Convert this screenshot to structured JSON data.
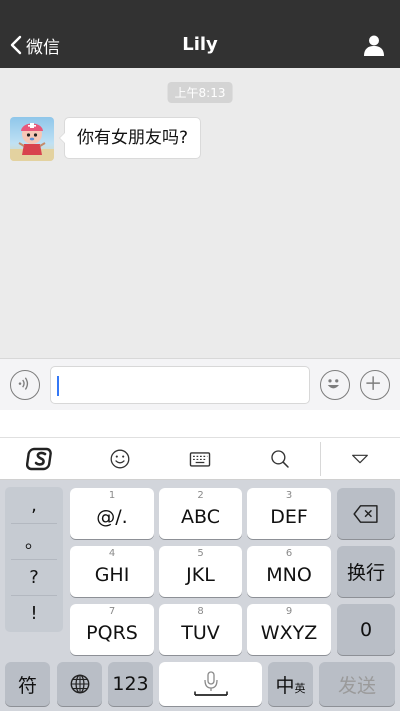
{
  "navbar": {
    "back_label": "微信",
    "title": "Lily",
    "profile_icon": "person-icon"
  },
  "chat": {
    "timestamp": "上午8:13",
    "messages": [
      {
        "sender": "Lily",
        "text": "你有女朋友吗?"
      }
    ]
  },
  "inputbar": {
    "voice_icon": "voice-icon",
    "text_value": "",
    "emoji_icon": "emoji-icon",
    "plus_icon": "plus-icon"
  },
  "keyboard_toolbar": {
    "items": [
      "sogou-logo-icon",
      "emoji-icon",
      "keyboard-icon",
      "search-icon",
      "collapse-icon"
    ]
  },
  "keyboard": {
    "punctuation": [
      ",",
      "。",
      "?",
      "!"
    ],
    "keys": [
      {
        "num": "1",
        "letters": "@/."
      },
      {
        "num": "2",
        "letters": "ABC"
      },
      {
        "num": "3",
        "letters": "DEF"
      },
      {
        "num": "4",
        "letters": "GHI"
      },
      {
        "num": "5",
        "letters": "JKL"
      },
      {
        "num": "6",
        "letters": "MNO"
      },
      {
        "num": "7",
        "letters": "PQRS"
      },
      {
        "num": "8",
        "letters": "TUV"
      },
      {
        "num": "9",
        "letters": "WXYZ"
      }
    ],
    "newline_label": "换行",
    "zero_label": "0",
    "symbols_label": "符",
    "num_label": "123",
    "lang_main": "中",
    "lang_sub": "英",
    "send_label": "发送"
  },
  "colors": {
    "navbar_bg": "#323232",
    "caret": "#3478f6",
    "keyboard_bg": "#d2d5db"
  }
}
